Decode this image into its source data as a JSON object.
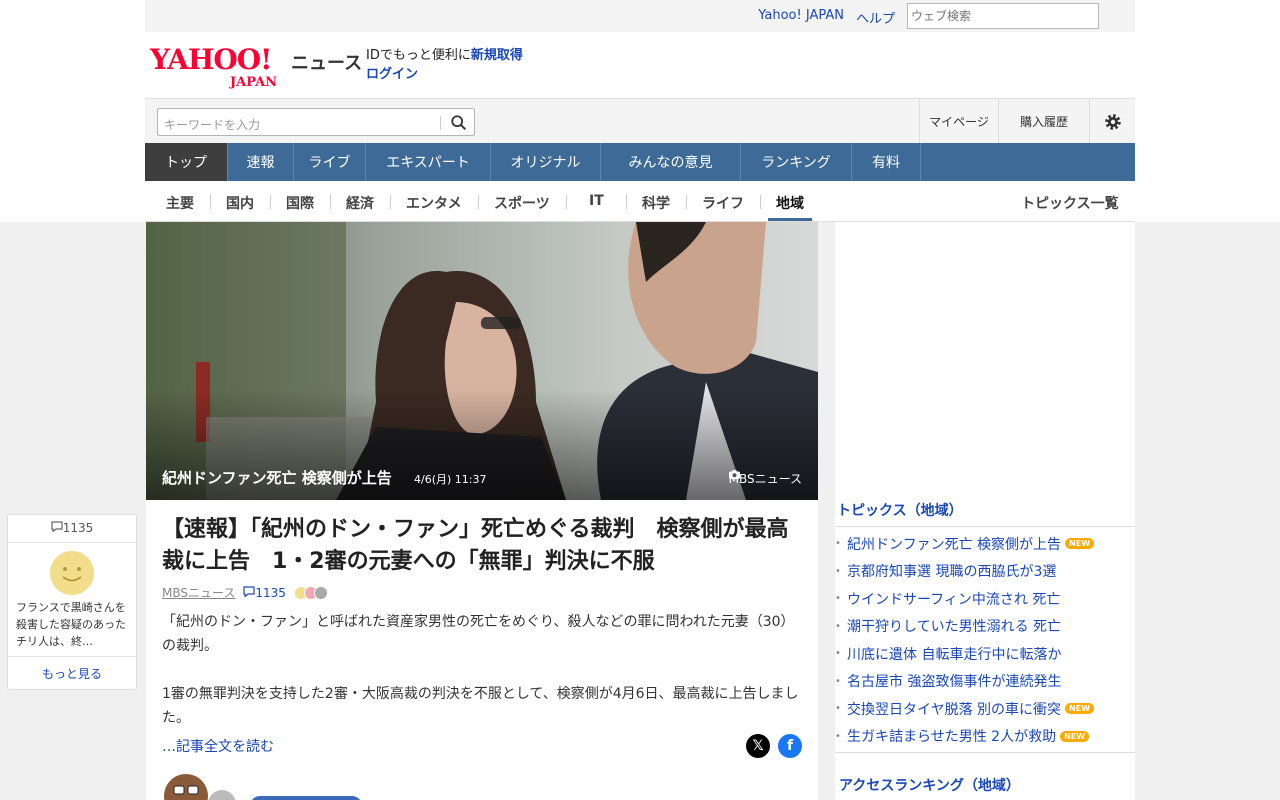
{
  "util": {
    "yahoo_japan": "Yahoo! JAPAN",
    "help": "ヘルプ",
    "web_search_placeholder": "ウェブ検索"
  },
  "header": {
    "logo_text": "YAHOO!",
    "logo_sub": "JAPAN",
    "news_title": "ニュース",
    "id_text": "IDでもっと便利に",
    "signup": "新規取得",
    "login": "ログイン"
  },
  "search": {
    "keyword_placeholder": "キーワードを入力",
    "mypage": "マイページ",
    "history": "購入履歴"
  },
  "main_nav": [
    {
      "label": "トップ"
    },
    {
      "label": "速報"
    },
    {
      "label": "ライブ"
    },
    {
      "label": "エキスパート"
    },
    {
      "label": "オリジナル"
    },
    {
      "label": "みんなの意見"
    },
    {
      "label": "ランキング"
    },
    {
      "label": "有料"
    }
  ],
  "sub_nav": [
    {
      "label": "主要"
    },
    {
      "label": "国内"
    },
    {
      "label": "国際"
    },
    {
      "label": "経済"
    },
    {
      "label": "エンタメ"
    },
    {
      "label": "スポーツ"
    },
    {
      "label": "IT"
    },
    {
      "label": "科学"
    },
    {
      "label": "ライフ"
    },
    {
      "label": "地域"
    }
  ],
  "topics_all": "トピックス一覧",
  "hero": {
    "caption": "紀州ドンファン死亡 検察側が上告",
    "datetime": "4/6(月) 11:37",
    "source": "MBSニュース"
  },
  "article": {
    "headline": "【速報】「紀州のドン・ファン」死亡めぐる裁判　検察側が最高裁に上告　1・2審の元妻への「無罪」判決に不服",
    "publisher": "MBSニュース",
    "comments": "1135",
    "para1": "「紀州のドン・ファン」と呼ばれた資産家男性の死亡をめぐり、殺人などの罪に問われた元妻（30）の裁判。",
    "para2": "1審の無罪判決を支持した2審・大阪高裁の判決を不服として、検察側が4月6日、最高裁に上告しました。",
    "read_more": "…記事全文を読む"
  },
  "left_float": {
    "count": "1135",
    "text": "フランスで黒崎さんを殺害した容疑のあったチリ人は、終…",
    "more": "もっと見る"
  },
  "topics": {
    "heading": "トピックス（地域）",
    "new_badge": "NEW",
    "items": [
      {
        "label": "紀州ドンファン死亡 検察側が上告",
        "new": true
      },
      {
        "label": "京都府知事選 現職の西脇氏が3選",
        "new": false
      },
      {
        "label": "ウインドサーフィン中流され 死亡",
        "new": false
      },
      {
        "label": "潮干狩りしていた男性溺れる 死亡",
        "new": false
      },
      {
        "label": "川底に遺体 自転車走行中に転落か",
        "new": false
      },
      {
        "label": "名古屋市 強盗致傷事件が連続発生",
        "new": false
      },
      {
        "label": "交換翌日タイヤ脱落 別の車に衝突",
        "new": true
      },
      {
        "label": "生ガキ詰まらせた男性 2人が救助",
        "new": true
      }
    ]
  },
  "ranking_heading": "アクセスランキング（地域）",
  "colors": {
    "nav_blue": "#3d6a96",
    "link_blue": "#1a47b8",
    "yahoo_red": "#ff0033",
    "new_badge": "#ffaa00"
  }
}
